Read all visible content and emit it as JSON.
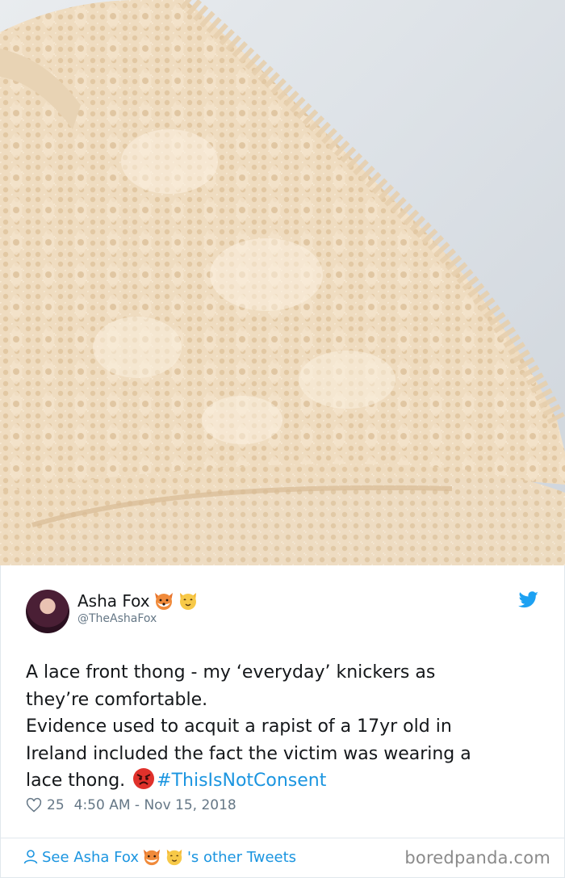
{
  "tweet": {
    "author_name": "Asha Fox",
    "handle": "@TheAshaFox",
    "text_lines": [
      "A lace front thong - my ‘everyday’ knickers as",
      "they’re comfortable.",
      "Evidence used to acquit a rapist of a 17yr old in",
      "Ireland included the fact the victim was wearing a",
      "lace thong."
    ],
    "hashtag": "#ThisIsNotConsent",
    "likes": "25",
    "timestamp": "4:50 AM - Nov 15, 2018"
  },
  "footer": {
    "see_prefix": "See Asha Fox",
    "see_suffix": "'s other Tweets",
    "watermark": "boredpanda.com"
  },
  "icons": {
    "name_emojis": [
      "fox-face-icon",
      "cat-face-icon"
    ],
    "angry": "angry-face-icon",
    "bird": "twitter-bird-icon",
    "heart": "heart-icon",
    "person": "person-icon"
  },
  "colors": {
    "link": "#1b95e0",
    "secondary": "#657786",
    "text": "#14171a"
  }
}
